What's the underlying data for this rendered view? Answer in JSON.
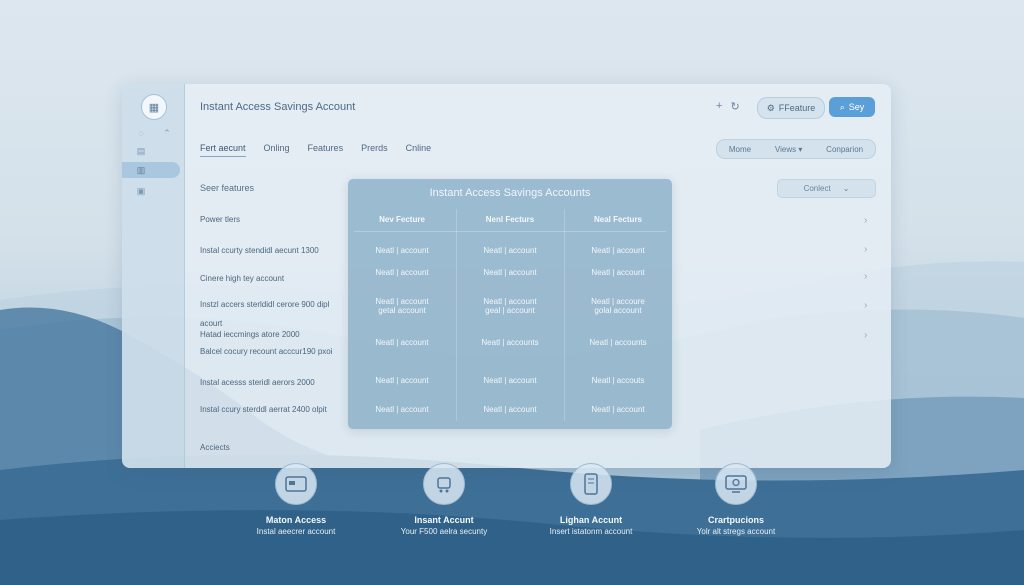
{
  "window": {
    "title": "Instant Access Savings Account",
    "feature_button": "FFeature",
    "say_button": "Sey"
  },
  "tabs": [
    "Fert aecunt",
    "Onling",
    "Features",
    "Prerds",
    "Cnline"
  ],
  "view_segment": [
    "Mome",
    "Views",
    "Conparion"
  ],
  "contact_select": "Conlect",
  "left_list": {
    "heading": "Seer features",
    "items": [
      "Power tlers",
      "Instal ccurty stendidl aecunt 1300",
      "Cinere high tey account",
      "Instzl accers sterldidl cerore 900 dipl",
      "acourt",
      "Hatad ieccmings atore 2000",
      "Balcel cocury recount acccur190 pxoi",
      "Instal acesss steridl aerors 2000",
      "Instal ccury sterddl aerrat 2400 olpit",
      "Acciects"
    ]
  },
  "table": {
    "title": "Instant Access Savings Accounts",
    "headers": [
      "Nev Fecture",
      "Nenl Fecturs",
      "Neal Fecturs"
    ],
    "rows": [
      [
        "Neatl | account",
        "Neatl | account",
        "Neatl | account"
      ],
      [
        "Neatl | account",
        "Neatl | account",
        "Neatl | account"
      ],
      [
        "Neatl | account\ngetal account",
        "Neatl | account\ngeal | account",
        "Neatl | accoure\ngolal account"
      ],
      [
        "Neatl | account",
        "Neatl | accounts",
        "Neatl | accounts"
      ],
      [
        "Neatl | account",
        "Neatl | account",
        "Neatl | accouts"
      ],
      [
        "Neatl | account",
        "Neatl | account",
        "Neatl | account"
      ]
    ]
  },
  "features": [
    {
      "title": "Maton Access",
      "desc": "Instal aeecrer account",
      "icon": "card-icon"
    },
    {
      "title": "Insant Accunt",
      "desc": "Your F500 aelra secunty",
      "icon": "cart-icon"
    },
    {
      "title": "Lighan Accunt",
      "desc": "Insert istatonm account",
      "icon": "phone-icon"
    },
    {
      "title": "Crartpucions",
      "desc": "Yolr alt stregs account",
      "icon": "monitor-icon"
    }
  ]
}
